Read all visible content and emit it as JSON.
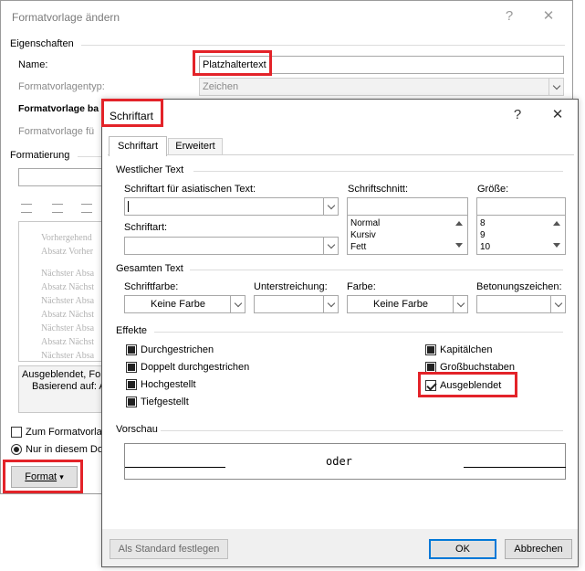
{
  "back_window": {
    "title": "Formatvorlage ändern",
    "help_glyph": "?",
    "close_glyph": "✕",
    "section_properties": "Eigenschaften",
    "name_label": "Name:",
    "name_value": "Platzhaltertext",
    "type_label": "Formatvorlagentyp:",
    "type_value": "Zeichen",
    "based_on_label": "Formatvorlage ba",
    "next_label": "Formatvorlage fü",
    "section_formatting": "Formatierung",
    "preview_lines": [
      "Vorhergehend",
      "Absatz Vorher",
      "Nächster Absa",
      "Absatz Nächst",
      "Nächster Absa",
      "Absatz Nächst",
      "Nächster Absa",
      "Absatz Nächst",
      "Nächster Absa"
    ],
    "description_line1": "Ausgeblendet, Fo",
    "description_line2": "Basierend auf: A",
    "add_to_gallery_label": "Zum Formatvorla",
    "only_this_doc_label": "Nur in diesem Do",
    "format_button": "Format",
    "format_button_arrow": "▾"
  },
  "font_dialog": {
    "title": "Schriftart",
    "help_glyph": "?",
    "close_glyph": "✕",
    "tabs": [
      {
        "label": "Schriftart",
        "active": true
      },
      {
        "label": "Erweitert",
        "active": false
      }
    ],
    "western_text": "Westlicher Text",
    "asian_font_label": "Schriftart für asiatischen Text:",
    "asian_font_value": "",
    "font_label": "Schriftart:",
    "font_value": "",
    "style_label": "Schriftschnitt:",
    "style_value": "",
    "style_options": [
      "Normal",
      "Kursiv",
      "Fett"
    ],
    "size_label": "Größe:",
    "size_value": "",
    "size_options": [
      "8",
      "9",
      "10"
    ],
    "all_text": "Gesamten Text",
    "font_color_label": "Schriftfarbe:",
    "font_color_value": "Keine Farbe",
    "underline_label": "Unterstreichung:",
    "underline_value": "",
    "color_label": "Farbe:",
    "color_value": "Keine Farbe",
    "emphasis_label": "Betonungszeichen:",
    "emphasis_value": "",
    "effects_label": "Effekte",
    "effects": {
      "strikethrough": {
        "label": "Durchgestrichen",
        "state": "indeterminate"
      },
      "double_strikethrough": {
        "label": "Doppelt durchgestrichen",
        "state": "indeterminate"
      },
      "superscript": {
        "label": "Hochgestellt",
        "state": "indeterminate"
      },
      "subscript": {
        "label": "Tiefgestellt",
        "state": "indeterminate"
      },
      "small_caps": {
        "label": "Kapitälchen",
        "state": "indeterminate"
      },
      "all_caps": {
        "label": "Großbuchstaben",
        "state": "indeterminate"
      },
      "hidden": {
        "label": "Ausgeblendet",
        "state": "checked"
      }
    },
    "preview_label": "Vorschau",
    "preview_text": "oder",
    "set_default_button": "Als Standard festlegen",
    "ok_button": "OK",
    "cancel_button": "Abbrechen"
  },
  "colors": {
    "highlight_red": "#e32329",
    "default_button_blue": "#0078d7"
  }
}
